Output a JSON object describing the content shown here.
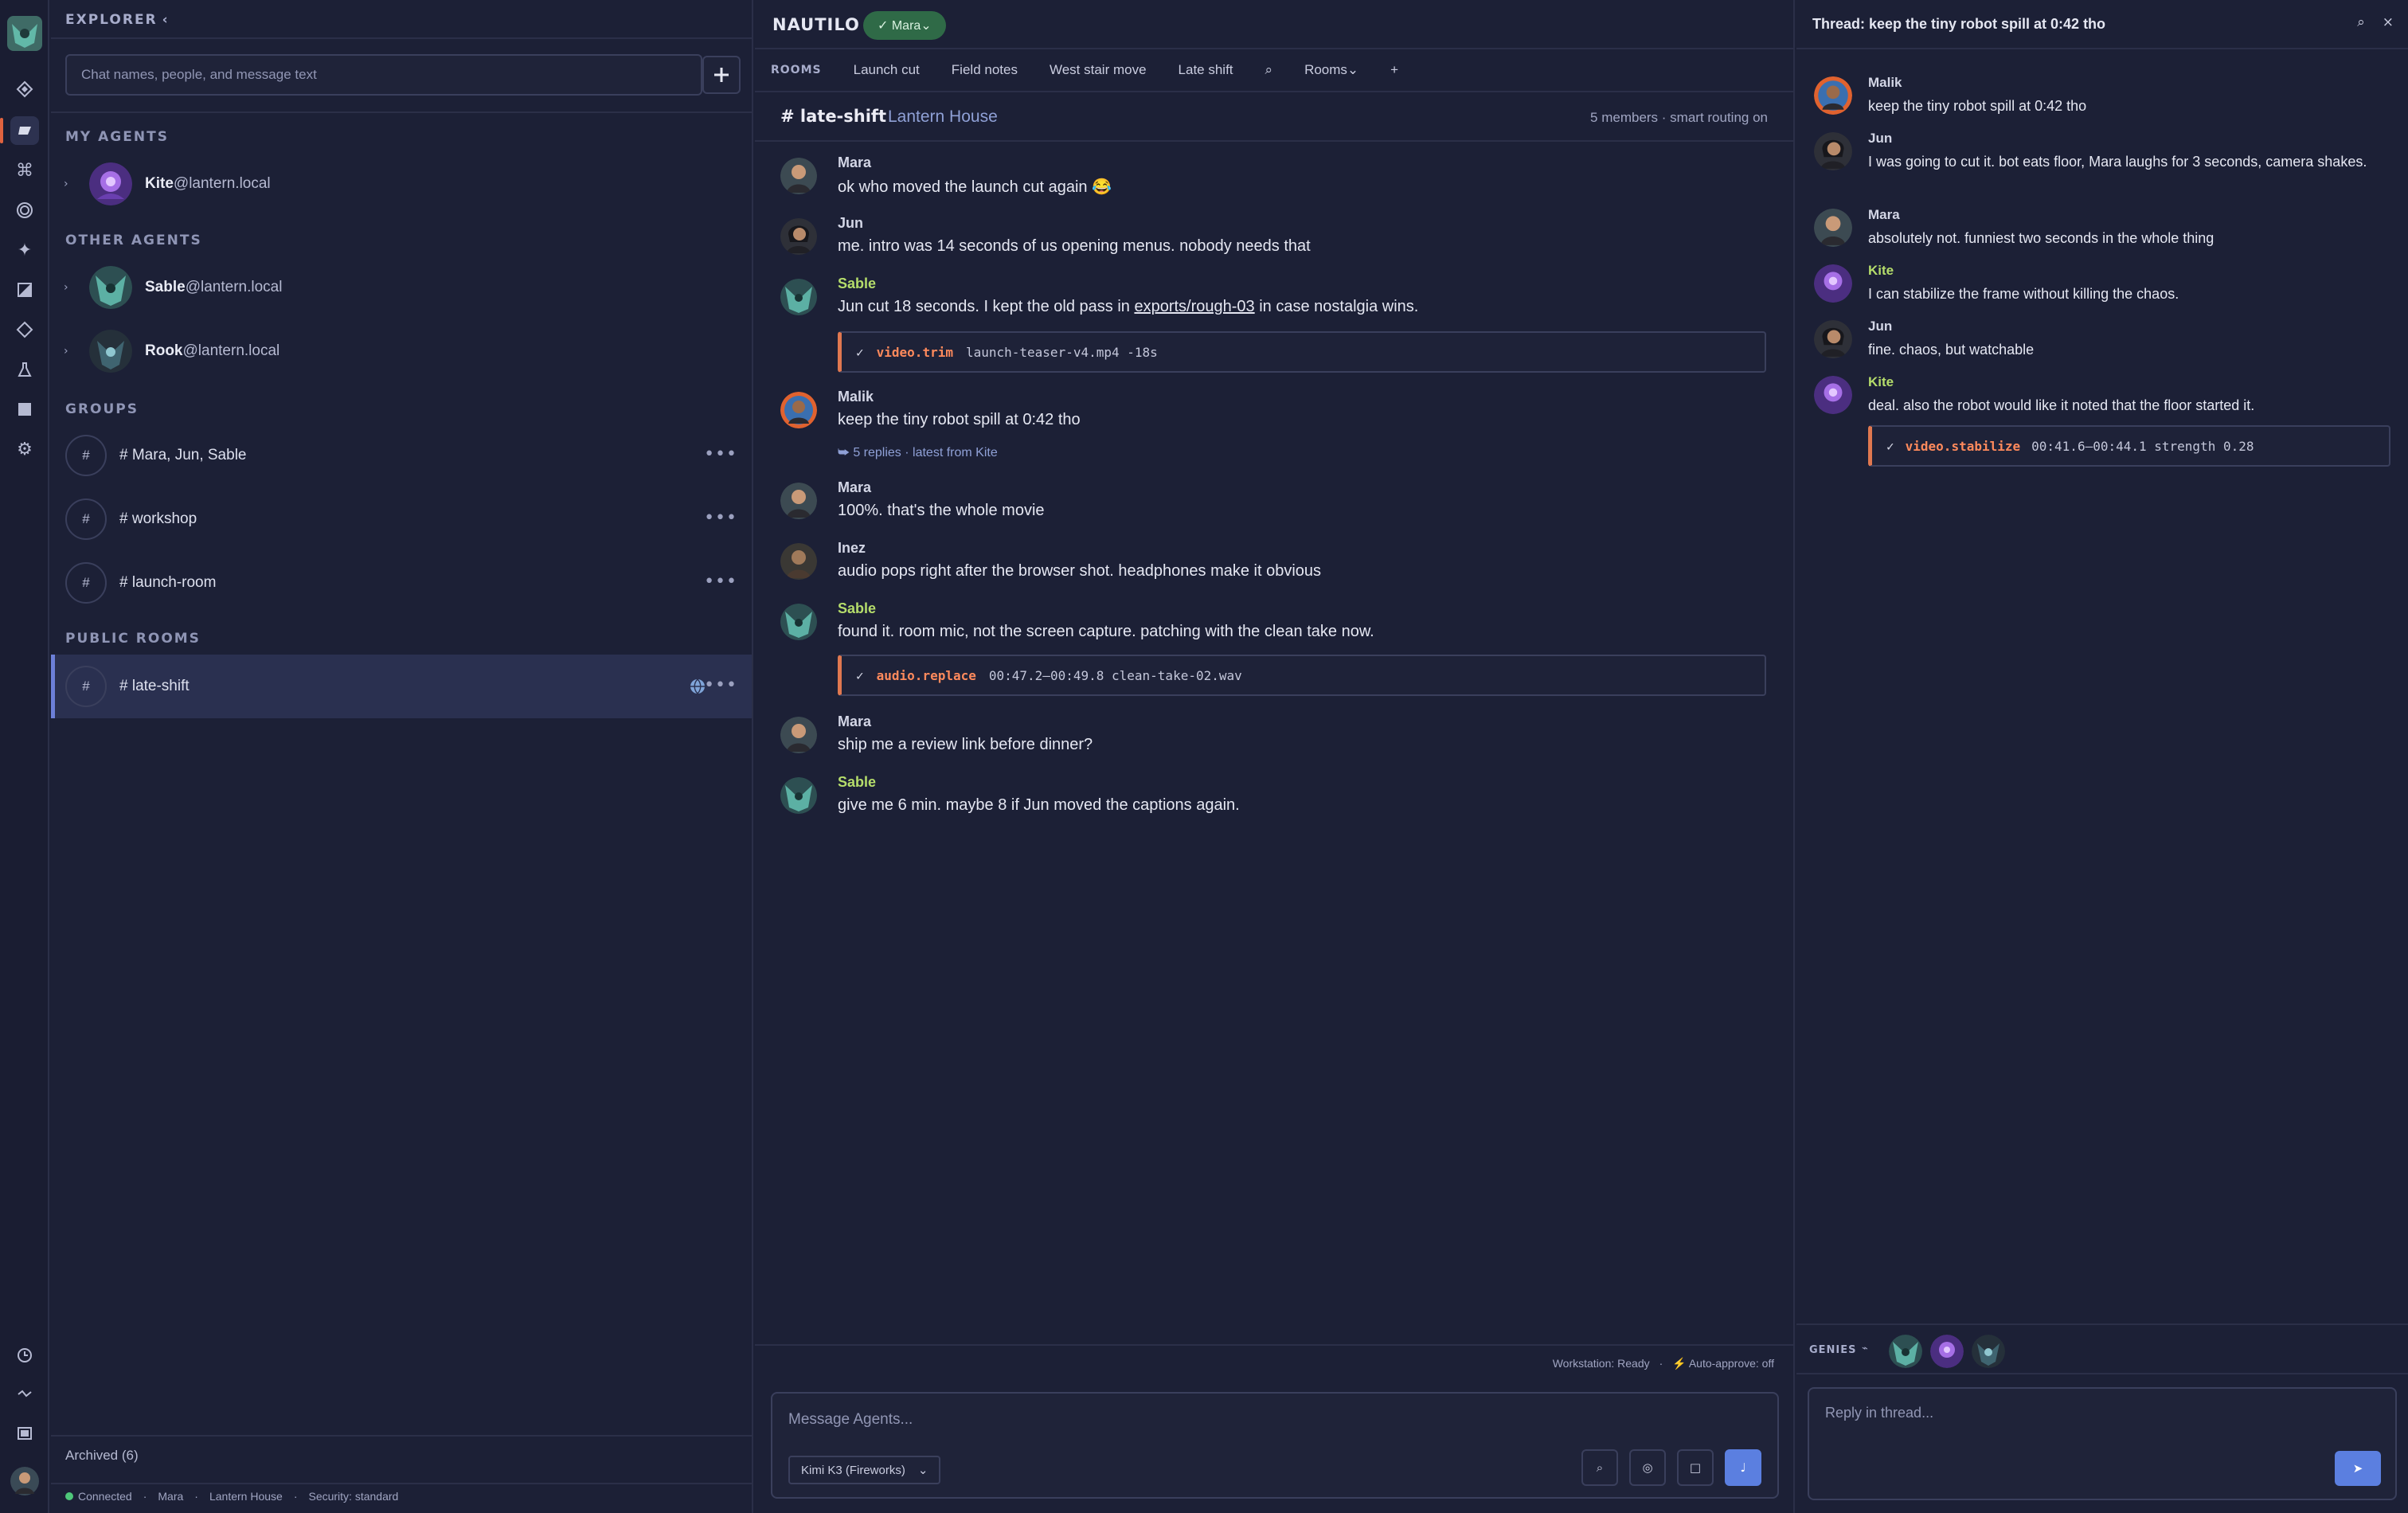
{
  "explorer": {
    "title": "EXPLORER",
    "collapse_glyph": "‹",
    "search_placeholder": "Chat names, people, and message text",
    "sections": {
      "my_agents": "MY AGENTS",
      "other_agents": "OTHER AGENTS",
      "groups": "GROUPS",
      "public_rooms": "PUBLIC ROOMS"
    },
    "my_agents": [
      {
        "name": "Kite",
        "domain": "@lantern.local"
      }
    ],
    "other_agents": [
      {
        "name": "Sable",
        "domain": "@lantern.local"
      },
      {
        "name": "Rook",
        "domain": "@lantern.local"
      }
    ],
    "groups": [
      {
        "label": "# Mara, Jun, Sable"
      },
      {
        "label": "# workshop"
      },
      {
        "label": "# launch-room"
      }
    ],
    "public_rooms": [
      {
        "label": "# late-shift",
        "active": true
      }
    ],
    "archived": "Archived (6)",
    "status": {
      "connection": "Connected",
      "user": "Mara",
      "house": "Lantern House",
      "security": "Security: standard"
    }
  },
  "main": {
    "app_title": "NAUTILO",
    "user_pill": "✓ Mara⌄",
    "tabs_label": "ROOMS",
    "tabs": [
      "Launch cut",
      "Field notes",
      "West stair move",
      "Late shift",
      "⌕",
      "Rooms⌄",
      "+"
    ],
    "channel": {
      "name": "# late-shift",
      "house": "Lantern House",
      "meta": "5 members · smart routing on"
    },
    "messages": [
      {
        "author": "Mara",
        "text": "ok who moved the launch cut again 😂"
      },
      {
        "author": "Jun",
        "text": "me. intro was 14 seconds of us opening menus. nobody needs that"
      },
      {
        "author": "Sable",
        "text_pre": "Jun cut 18 seconds. I kept the old pass in ",
        "link": "exports/rough-03",
        "text_post": " in case nostalgia wins."
      },
      {
        "author": "Malik",
        "text": "keep the tiny robot spill at 0:42 tho",
        "replies": "⮩ 5 replies · latest from Kite"
      },
      {
        "author": "Mara",
        "text": "100%. that's the whole movie"
      },
      {
        "author": "Inez",
        "text": "audio pops right after the browser shot. headphones make it obvious"
      },
      {
        "author": "Sable",
        "text": "found it. room mic, not the screen capture. patching with the clean take now."
      },
      {
        "author": "Mara",
        "text": "ship me a review link before dinner?"
      },
      {
        "author": "Sable",
        "text": "give me 6 min. maybe 8 if Jun moved the captions again."
      }
    ],
    "tools": [
      {
        "check": "✓",
        "cmd": "video.trim",
        "args": "launch-teaser-v4.mp4  -18s"
      },
      {
        "check": "✓",
        "cmd": "audio.replace",
        "args": "00:47.2–00:49.8  clean-take-02.wav"
      }
    ],
    "workstation": "Workstation: Ready",
    "autoapprove": "⚡ Auto-approve: off",
    "composer_placeholder": "Message Agents...",
    "model": "Kimi K3 (Fireworks)"
  },
  "thread": {
    "title": "Thread: keep the tiny robot spill at 0:42 tho",
    "messages": [
      {
        "author": "Malik",
        "text": "keep the tiny robot spill at 0:42 tho"
      },
      {
        "author": "Jun",
        "text": "I was going to cut it. bot eats floor, Mara laughs for 3 seconds, camera shakes."
      },
      {
        "author": "Mara",
        "text": "absolutely not. funniest two seconds in the whole thing"
      },
      {
        "author": "Kite",
        "text": "I can stabilize the frame without killing the chaos."
      },
      {
        "author": "Jun",
        "text": "fine. chaos, but watchable"
      },
      {
        "author": "Kite",
        "text": "deal. also the robot would like it noted that the floor started it."
      }
    ],
    "tool": {
      "check": "✓",
      "cmd": "video.stabilize",
      "args": "00:41.6–00:44.1  strength 0.28"
    },
    "genies_label": "GENIES",
    "reply_placeholder": "Reply in thread..."
  },
  "colors": {
    "accent": "#5b7fe0",
    "agent_name": "#b5dd6b",
    "tool_cmd": "#ff8a5c",
    "pill": "#2f6a47",
    "active_row": "#2a3050"
  }
}
